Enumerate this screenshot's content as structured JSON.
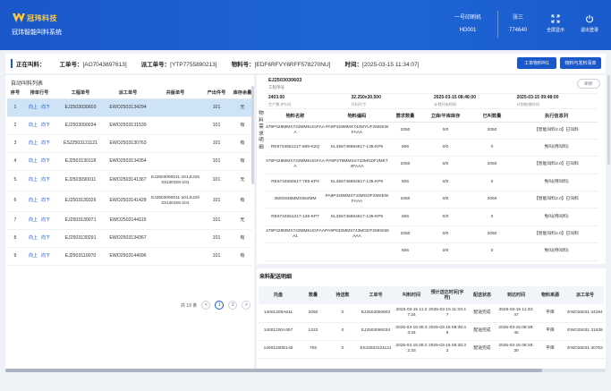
{
  "header": {
    "logo_text": "冠玮科技",
    "system_title": "冠玮智能叫料系统",
    "machine_label": "一号印刷机",
    "machine_value": "HD001",
    "user_label": "张三",
    "user_value": "774640",
    "fullscreen_label": "全屏显示",
    "logout_label": "退出登录"
  },
  "infobar": {
    "status_label": "正在叫料：",
    "work_order_label": "工单号：",
    "work_order_value": "[AO7043897613]",
    "dispatch_label": "派工单号：",
    "dispatch_value": "[YTP7755890213]",
    "material_label": "物料号：",
    "material_value": "[EDF6RFVY6RFF578270NU]",
    "time_label": "时间：",
    "time_value": "[2025-03-15 11:34:07]",
    "btn_call": "工单物料叫1",
    "btn_info": "物料与发料清单"
  },
  "left": {
    "title": "自动叫料列表",
    "columns": [
      "序号",
      "排单行号",
      "工程单号",
      "派工单号",
      "共版单号",
      "产出件号",
      "库存余量"
    ],
    "op_up": "向上",
    "op_down": "向下",
    "rows": [
      {
        "no": "1",
        "project": "EJ2503030603",
        "dispatch": "EWO2503134294",
        "share": "",
        "output": "101",
        "stock": "无"
      },
      {
        "no": "2",
        "project": "EJ2503090034",
        "dispatch": "EWO2503131539",
        "share": "",
        "output": "101",
        "stock": "有"
      },
      {
        "no": "3",
        "project": "ESJ2503121121",
        "dispatch": "EWO2503130763",
        "share": "",
        "output": "101",
        "stock": "有"
      },
      {
        "no": "4",
        "project": "EJ2503130118",
        "dispatch": "EWO2503134354",
        "share": "",
        "output": "101",
        "stock": "有"
      },
      {
        "no": "5",
        "project": "EJ2503090011",
        "dispatch": "EWO2503141367",
        "share": "EJ2503090011-101,EJ2503130326-101",
        "output": "101",
        "stock": "无"
      },
      {
        "no": "6",
        "project": "EJ2503130326",
        "dispatch": "EWO2503141428",
        "share": "EJ2503090011-101,EJ2503130326-101",
        "output": "101",
        "stock": "有"
      },
      {
        "no": "7",
        "project": "EJ2503130071",
        "dispatch": "EWO2503144119",
        "share": "",
        "output": "101",
        "stock": "无"
      },
      {
        "no": "8",
        "project": "EJ2503130291",
        "dispatch": "EWO2503134367",
        "share": "",
        "output": "101",
        "stock": "有"
      },
      {
        "no": "9",
        "project": "EJ2503110070",
        "dispatch": "EWO2503144096",
        "share": "",
        "output": "101",
        "stock": "有"
      }
    ],
    "pager_total": "共 19 条",
    "pager_prev": "<",
    "pager_next": ">",
    "pages": [
      "1",
      "2"
    ]
  },
  "right_top": {
    "wo_code": "EJ2503030603",
    "wo_sub": "工程单号",
    "refresh": "刷新",
    "stats": [
      {
        "value": "2403.00",
        "label": "生产数 (PCS)"
      },
      {
        "value": "32.250x30.500",
        "label": "开料尺寸"
      },
      {
        "value": "2025-03-15 08:46:00",
        "label": "计划开始时间"
      },
      {
        "value": "2025-03-15 09:48:00",
        "label": "计划结束时间"
      }
    ],
    "vlabel": "物料需求明细",
    "columns": [
      "物料名称",
      "物料编码",
      "需求数量",
      "立库/平库库存",
      "已叫数量",
      "执行信息列"
    ],
    "rows": [
      {
        "name": "479P429MMX743MMKUGFAAA",
        "code": "PA9P429MMX743MYUF2MKEWFAAA",
        "qty": "2050",
        "stock": "0/0",
        "called": "2050",
        "info": "【智能叫料2.0】已叫料"
      },
      {
        "name": "RE6734551217-589-K2Q",
        "code": "KL356746864817-135-KP8",
        "qty": "606",
        "stock": "0/0",
        "called": "0",
        "info": "免叫(待叫料)"
      },
      {
        "name": "479P429MMX743MMKUGFAAA",
        "code": "PA9P4T9MMSX743MGDF2MKT4FAAA",
        "qty": "2050",
        "stock": "0/0",
        "called": "2050",
        "info": "【智能叫料2.0】已叫料"
      },
      {
        "name": "RE6734550617-765-KP4",
        "code": "KL356746864817-135-KP8",
        "qty": "606",
        "stock": "0/0",
        "called": "0",
        "info": "免叫(待叫料)"
      },
      {
        "name": "350G836MMX664MM",
        "code": "PA9P429MMX743MGDF2MKEWFAAA",
        "qty": "2050",
        "stock": "0/0",
        "called": "2050",
        "info": "【智能叫料2.0】已叫料"
      },
      {
        "name": "RE6734551217-135-KP7",
        "code": "KL356746864817-135-KP8",
        "qty": "606",
        "stock": "0/0",
        "called": "0",
        "info": "免叫(待叫料)"
      },
      {
        "name": "479P429MMX743MMKUGFAAA1",
        "code": "PA9P632MMX743MGDF2MKE56AAA",
        "qty": "2050",
        "stock": "0/0",
        "called": "2050",
        "info": "【智能叫料2.0】已叫料"
      },
      {
        "name": "",
        "code": "",
        "qty": "606",
        "stock": "0/0",
        "called": "0",
        "info": "免叫(待叫料)"
      }
    ]
  },
  "right_bottom": {
    "title": "来料配送明细",
    "columns": [
      "托盘",
      "数量",
      "待送数",
      "工单号",
      "叫料时间",
      "预计送达时间(字符)",
      "配送状态",
      "到达时间",
      "物料来源",
      "派工单号"
    ],
    "rows": [
      {
        "tray": "14001200A611",
        "qty": "2050",
        "pending": "0",
        "wo": "EJ2503050603",
        "call": "2025-03-15 11:27:34",
        "eta": "2025-03-15 11:33:47",
        "status": "配送完成",
        "arrive": "2025-03-15 11:33:47",
        "src": "平库",
        "dispatch": "EWO25031 34294"
      },
      {
        "tray": "14001200A357",
        "qty": "1222",
        "pending": "0",
        "wo": "EJ2503090034",
        "call": "2025-03-15 08:33:34",
        "eta": "2025-03-15 08:39:49",
        "status": "配送完成",
        "arrive": "2025-03-15 08:39:46",
        "src": "平库",
        "dispatch": "EWO25031 31539"
      },
      {
        "tray": "14001200D145",
        "qty": "765",
        "pending": "0",
        "wo": "ESJ2503121121",
        "call": "2025-03-15 08:22:33",
        "eta": "2025-03-15 08:28:32",
        "status": "配送完成",
        "arrive": "2025-03-15 08:28:30",
        "src": "平库",
        "dispatch": "EWO25031 30763"
      }
    ]
  },
  "colors": {
    "header_blue": "#1a57c9",
    "selected_row": "#cfe3f7",
    "logo_gold": "#ffcc33"
  }
}
